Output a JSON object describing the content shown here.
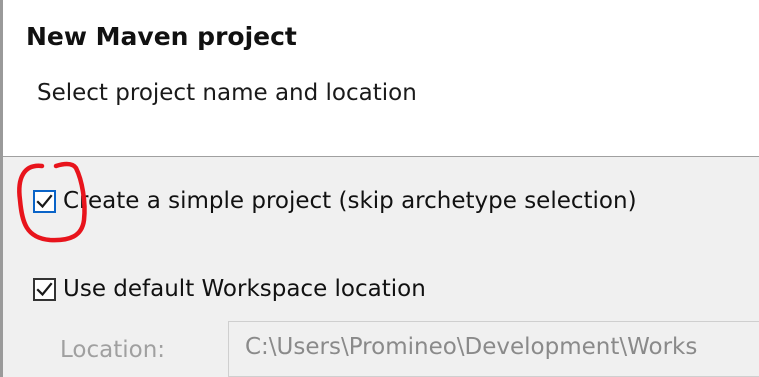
{
  "dialog": {
    "title": "New Maven project",
    "subtitle": "Select project name and location"
  },
  "options": {
    "simple_project": {
      "label": "Create a simple project (skip archetype selection)",
      "checked": true
    },
    "default_workspace": {
      "label": "Use default Workspace location",
      "checked": true
    }
  },
  "location": {
    "label": "Location:",
    "value": "C:\\Users\\Promineo\\Development\\Works"
  },
  "icons": {
    "checkmark": "check-icon",
    "annotation": "red-circle-annotation"
  },
  "colors": {
    "header_bg": "#ffffff",
    "content_bg": "#f0f0f0",
    "checkbox_focus": "#0a64c8",
    "check_mark": "#1a1a1a",
    "annotation": "#e8141c",
    "disabled_text": "#a0a0a0"
  }
}
